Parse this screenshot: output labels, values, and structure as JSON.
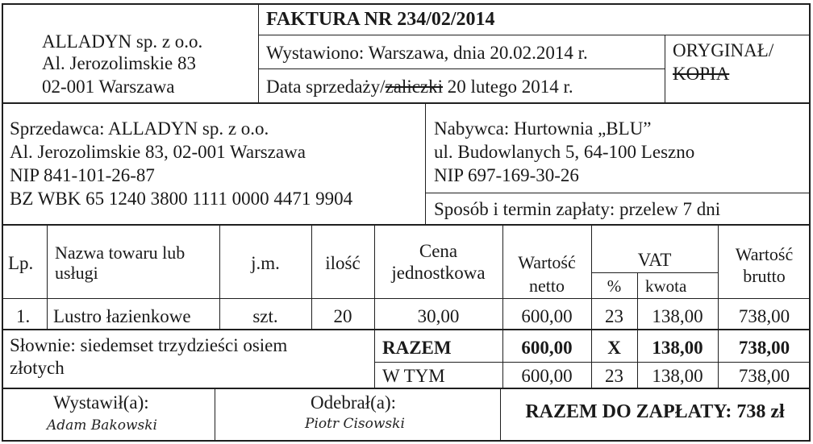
{
  "header": {
    "company_name": "ALLADYN sp. z o.o.",
    "company_street": "Al. Jerozolimskie 83",
    "company_city": "02-001 Warszawa",
    "invoice_title": "FAKTURA NR 234/02/2014",
    "issued_line": "Wystawiono: Warszawa, dnia 20.02.2014 r.",
    "sale_date_label": "Data sprzedaży/",
    "sale_date_struck": "zaliczki",
    "sale_date_value": " 20 lutego 2014 r.",
    "original_label": "ORYGINAŁ/",
    "copy_label": "KOPIA"
  },
  "seller": {
    "line1": "Sprzedawca: ALLADYN sp. z o.o.",
    "line2": "Al. Jerozolimskie 83, 02-001 Warszawa",
    "line3": "NIP 841-101-26-87",
    "line4": "BZ WBK 65 1240 3800 1111 0000 4471 9904"
  },
  "buyer": {
    "line1": "Nabywca: Hurtownia „BLU”",
    "line2": "ul. Budowlanych 5, 64-100 Leszno",
    "line3": "NIP 697-169-30-26",
    "payment": "Sposób i termin zapłaty: przelew 7 dni"
  },
  "table": {
    "headers": {
      "lp": "Lp.",
      "name_1": "Nazwa towaru lub",
      "name_2": "usługi",
      "unit": "j.m.",
      "qty": "ilość",
      "price_1": "Cena",
      "price_2": "jednostkowa",
      "net_1": "Wartość",
      "net_2": "netto",
      "vat": "VAT",
      "vat_pct": "%",
      "vat_amount": "kwota",
      "gross_1": "Wartość",
      "gross_2": "brutto"
    },
    "row": {
      "lp": "1.",
      "name": "Lustro łazienkowe",
      "unit": "szt.",
      "qty": "20",
      "price": "30,00",
      "net": "600,00",
      "vat_pct": "23",
      "vat_amount": "138,00",
      "gross": "738,00"
    }
  },
  "summary": {
    "words_1": "Słownie: siedemset trzydzieści osiem",
    "words_2": "złotych",
    "total_label": "RAZEM",
    "total_net": "600,00",
    "total_pct": "X",
    "total_vat": "138,00",
    "total_gross": "738,00",
    "incl_label": "W TYM",
    "incl_net": "600,00",
    "incl_pct": "23",
    "incl_vat": "138,00",
    "incl_gross": "738,00"
  },
  "footer": {
    "issued_by_label": "Wystawił(a):",
    "issued_by_sign": "Adam Bakowski",
    "received_by_label": "Odebrał(a):",
    "received_by_sign": "Piotr Cisowski",
    "to_pay": "RAZEM DO ZAPŁATY: 738 zł"
  }
}
